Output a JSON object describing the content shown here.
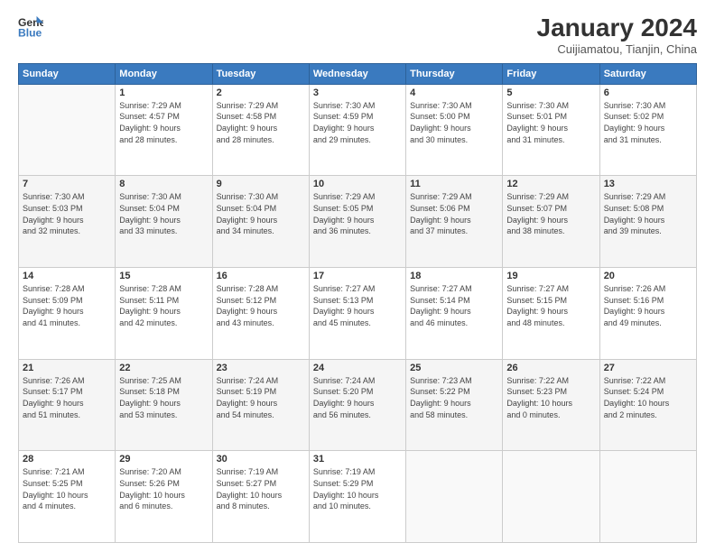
{
  "logo": {
    "general": "General",
    "blue": "Blue"
  },
  "header": {
    "month_title": "January 2024",
    "location": "Cuijiamatou, Tianjin, China"
  },
  "weekdays": [
    "Sunday",
    "Monday",
    "Tuesday",
    "Wednesday",
    "Thursday",
    "Friday",
    "Saturday"
  ],
  "weeks": [
    [
      {
        "day": "",
        "info": ""
      },
      {
        "day": "1",
        "info": "Sunrise: 7:29 AM\nSunset: 4:57 PM\nDaylight: 9 hours\nand 28 minutes."
      },
      {
        "day": "2",
        "info": "Sunrise: 7:29 AM\nSunset: 4:58 PM\nDaylight: 9 hours\nand 28 minutes."
      },
      {
        "day": "3",
        "info": "Sunrise: 7:30 AM\nSunset: 4:59 PM\nDaylight: 9 hours\nand 29 minutes."
      },
      {
        "day": "4",
        "info": "Sunrise: 7:30 AM\nSunset: 5:00 PM\nDaylight: 9 hours\nand 30 minutes."
      },
      {
        "day": "5",
        "info": "Sunrise: 7:30 AM\nSunset: 5:01 PM\nDaylight: 9 hours\nand 31 minutes."
      },
      {
        "day": "6",
        "info": "Sunrise: 7:30 AM\nSunset: 5:02 PM\nDaylight: 9 hours\nand 31 minutes."
      }
    ],
    [
      {
        "day": "7",
        "info": "Sunrise: 7:30 AM\nSunset: 5:03 PM\nDaylight: 9 hours\nand 32 minutes."
      },
      {
        "day": "8",
        "info": "Sunrise: 7:30 AM\nSunset: 5:04 PM\nDaylight: 9 hours\nand 33 minutes."
      },
      {
        "day": "9",
        "info": "Sunrise: 7:30 AM\nSunset: 5:04 PM\nDaylight: 9 hours\nand 34 minutes."
      },
      {
        "day": "10",
        "info": "Sunrise: 7:29 AM\nSunset: 5:05 PM\nDaylight: 9 hours\nand 36 minutes."
      },
      {
        "day": "11",
        "info": "Sunrise: 7:29 AM\nSunset: 5:06 PM\nDaylight: 9 hours\nand 37 minutes."
      },
      {
        "day": "12",
        "info": "Sunrise: 7:29 AM\nSunset: 5:07 PM\nDaylight: 9 hours\nand 38 minutes."
      },
      {
        "day": "13",
        "info": "Sunrise: 7:29 AM\nSunset: 5:08 PM\nDaylight: 9 hours\nand 39 minutes."
      }
    ],
    [
      {
        "day": "14",
        "info": "Sunrise: 7:28 AM\nSunset: 5:09 PM\nDaylight: 9 hours\nand 41 minutes."
      },
      {
        "day": "15",
        "info": "Sunrise: 7:28 AM\nSunset: 5:11 PM\nDaylight: 9 hours\nand 42 minutes."
      },
      {
        "day": "16",
        "info": "Sunrise: 7:28 AM\nSunset: 5:12 PM\nDaylight: 9 hours\nand 43 minutes."
      },
      {
        "day": "17",
        "info": "Sunrise: 7:27 AM\nSunset: 5:13 PM\nDaylight: 9 hours\nand 45 minutes."
      },
      {
        "day": "18",
        "info": "Sunrise: 7:27 AM\nSunset: 5:14 PM\nDaylight: 9 hours\nand 46 minutes."
      },
      {
        "day": "19",
        "info": "Sunrise: 7:27 AM\nSunset: 5:15 PM\nDaylight: 9 hours\nand 48 minutes."
      },
      {
        "day": "20",
        "info": "Sunrise: 7:26 AM\nSunset: 5:16 PM\nDaylight: 9 hours\nand 49 minutes."
      }
    ],
    [
      {
        "day": "21",
        "info": "Sunrise: 7:26 AM\nSunset: 5:17 PM\nDaylight: 9 hours\nand 51 minutes."
      },
      {
        "day": "22",
        "info": "Sunrise: 7:25 AM\nSunset: 5:18 PM\nDaylight: 9 hours\nand 53 minutes."
      },
      {
        "day": "23",
        "info": "Sunrise: 7:24 AM\nSunset: 5:19 PM\nDaylight: 9 hours\nand 54 minutes."
      },
      {
        "day": "24",
        "info": "Sunrise: 7:24 AM\nSunset: 5:20 PM\nDaylight: 9 hours\nand 56 minutes."
      },
      {
        "day": "25",
        "info": "Sunrise: 7:23 AM\nSunset: 5:22 PM\nDaylight: 9 hours\nand 58 minutes."
      },
      {
        "day": "26",
        "info": "Sunrise: 7:22 AM\nSunset: 5:23 PM\nDaylight: 10 hours\nand 0 minutes."
      },
      {
        "day": "27",
        "info": "Sunrise: 7:22 AM\nSunset: 5:24 PM\nDaylight: 10 hours\nand 2 minutes."
      }
    ],
    [
      {
        "day": "28",
        "info": "Sunrise: 7:21 AM\nSunset: 5:25 PM\nDaylight: 10 hours\nand 4 minutes."
      },
      {
        "day": "29",
        "info": "Sunrise: 7:20 AM\nSunset: 5:26 PM\nDaylight: 10 hours\nand 6 minutes."
      },
      {
        "day": "30",
        "info": "Sunrise: 7:19 AM\nSunset: 5:27 PM\nDaylight: 10 hours\nand 8 minutes."
      },
      {
        "day": "31",
        "info": "Sunrise: 7:19 AM\nSunset: 5:29 PM\nDaylight: 10 hours\nand 10 minutes."
      },
      {
        "day": "",
        "info": ""
      },
      {
        "day": "",
        "info": ""
      },
      {
        "day": "",
        "info": ""
      }
    ]
  ]
}
